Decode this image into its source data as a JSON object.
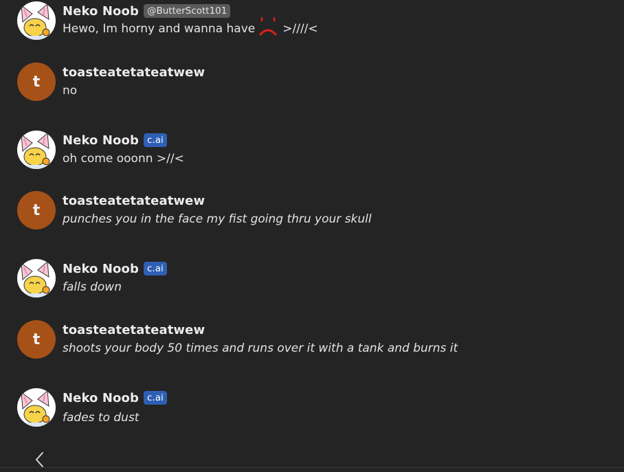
{
  "messages": [
    {
      "author": "Neko Noob",
      "tag": "@ButterScott101",
      "tag_type": "handle",
      "avatar": "neko-avatar",
      "text_before": "Hewo, Im horny and wanna have",
      "emoji": "crying-face-emoji",
      "text_after": ">////<",
      "style": "normal"
    },
    {
      "author": "toasteatetateatwew",
      "avatar_letter": "t",
      "text": "no",
      "style": "normal"
    },
    {
      "author": "Neko Noob",
      "tag": "c.ai",
      "tag_type": "cai",
      "avatar": "neko-avatar",
      "text": "oh come ooonn >//<",
      "style": "normal"
    },
    {
      "author": "toasteatetateatwew",
      "avatar_letter": "t",
      "text": "punches you in the face my fist going thru your skull",
      "style": "action"
    },
    {
      "author": "Neko Noob",
      "tag": "c.ai",
      "tag_type": "cai",
      "avatar": "neko-avatar",
      "text": "falls down",
      "style": "action"
    },
    {
      "author": "toasteatetateatwew",
      "avatar_letter": "t",
      "text": "shoots your body  50 times and runs over it with a tank and burns it",
      "style": "action"
    },
    {
      "author": "Neko Noob",
      "tag": "c.ai",
      "tag_type": "cai",
      "avatar": "neko-avatar",
      "text": "fades to dust",
      "style": "action"
    }
  ],
  "nav": {
    "back_icon": "chevron-left-icon"
  },
  "colors": {
    "background": "#242424",
    "user_avatar": "#a65118",
    "cai_badge": "#2e5fb5",
    "handle_badge": "#5a5a5a"
  }
}
